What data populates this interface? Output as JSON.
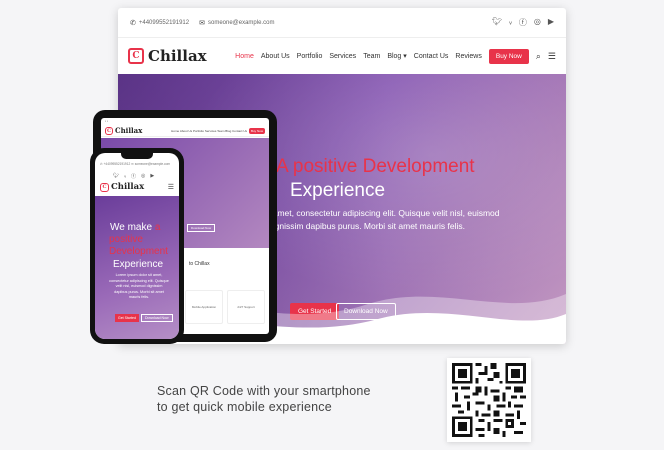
{
  "colors": {
    "accent": "#e8334a",
    "hero_purple": "#7a4aa8"
  },
  "desktop": {
    "topbar": {
      "phone": "+44099552191912",
      "email": "someone@example.com",
      "social_icons": [
        "twitter-icon",
        "vimeo-icon",
        "facebook-icon",
        "instagram-icon",
        "youtube-icon"
      ]
    },
    "logo": "Chillax",
    "menu": [
      "Home",
      "About Us",
      "Portfolio",
      "Services",
      "Team",
      "Blog ▾",
      "Contact Us",
      "Reviews"
    ],
    "buy_now": "Buy Now",
    "hero": {
      "title_line1": "A positive Development",
      "title_line2": "Experience",
      "text_line1": "t amet, consectetur adipiscing elit. Quisque velit nisl, euismod",
      "text_line2": "dignissim dapibus purus. Morbi sit amet mauris felis.",
      "get_started": "Get Started",
      "download": "Download Now"
    }
  },
  "tablet": {
    "logo": "Chillax",
    "menu": "Home  About Us  Portfolio  Services  Team  Blog  Contact Us",
    "buy": "Buy Now",
    "download": "Download Now",
    "welcome": "to Chillax",
    "cards": [
      "Mobile Application",
      "24/7 Support"
    ]
  },
  "phone": {
    "phone": "+44099552191912",
    "email": "someone@example.com",
    "logo": "Chillax",
    "hero": {
      "we_make": "We make",
      "of": "a",
      "l2": "positive",
      "l3": "Development",
      "l4": "Experience",
      "text": "Lorem ipsum dolor sit amet, consectetur adipiscing elit. Quisque velit nisl, euismod dignissim dapibus purus. Morbi sit amet mauris felis.",
      "get_started": "Get Started",
      "download": "Download Now"
    }
  },
  "caption": {
    "line1": "Scan QR Code with your smartphone",
    "line2": "to get quick mobile experience"
  }
}
